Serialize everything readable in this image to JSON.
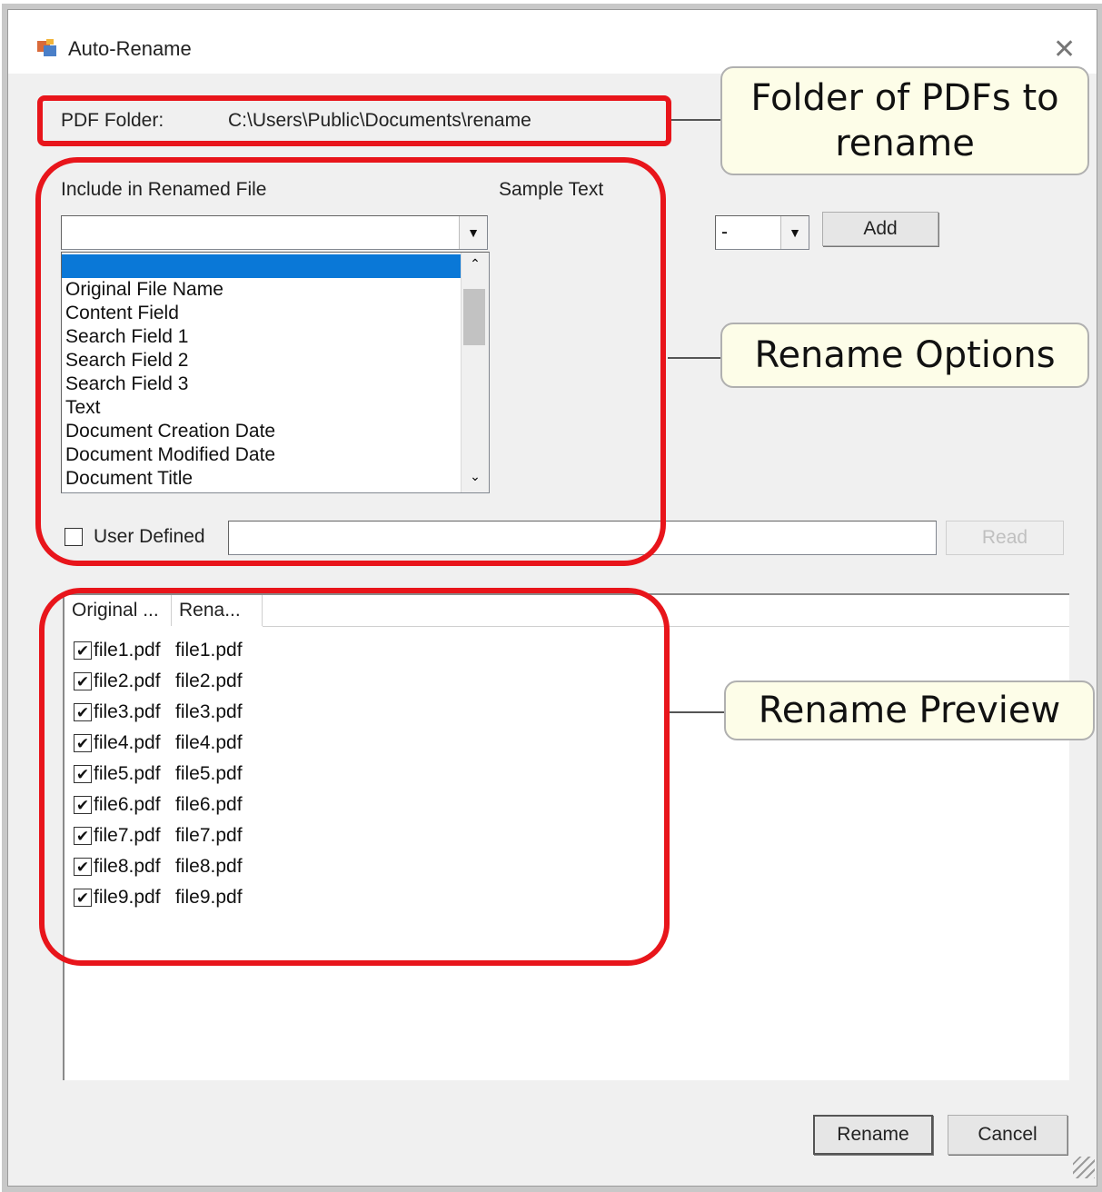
{
  "window": {
    "title": "Auto-Rename",
    "close_glyph": "✕"
  },
  "folder": {
    "label": "PDF Folder:",
    "path": "C:\\Users\\Public\\Documents\\rename"
  },
  "include": {
    "label": "Include in Renamed File",
    "sample_label": "Sample Text",
    "combo_value": "",
    "list_items": [
      "",
      "Original File Name",
      "Content Field",
      "Search Field 1",
      "Search Field 2",
      "Search Field 3",
      "Text",
      "Document Creation Date",
      "Document Modified Date",
      "Document Title"
    ],
    "selected_index": 0
  },
  "separator": {
    "value": "-",
    "add_label": "Add"
  },
  "user_defined": {
    "label": "User Defined",
    "checked": false,
    "value": "",
    "read_label": "Read"
  },
  "preview": {
    "columns": [
      "Original ...",
      "Rena..."
    ],
    "rows": [
      {
        "original": "file1.pdf",
        "renamed": "file1.pdf",
        "checked": true
      },
      {
        "original": "file2.pdf",
        "renamed": "file2.pdf",
        "checked": true
      },
      {
        "original": "file3.pdf",
        "renamed": "file3.pdf",
        "checked": true
      },
      {
        "original": "file4.pdf",
        "renamed": "file4.pdf",
        "checked": true
      },
      {
        "original": "file5.pdf",
        "renamed": "file5.pdf",
        "checked": true
      },
      {
        "original": "file6.pdf",
        "renamed": "file6.pdf",
        "checked": true
      },
      {
        "original": "file7.pdf",
        "renamed": "file7.pdf",
        "checked": true
      },
      {
        "original": "file8.pdf",
        "renamed": "file8.pdf",
        "checked": true
      },
      {
        "original": "file9.pdf",
        "renamed": "file9.pdf",
        "checked": true
      }
    ]
  },
  "buttons": {
    "rename": "Rename",
    "cancel": "Cancel"
  },
  "callouts": {
    "folder": "Folder of PDFs to rename",
    "options": "Rename Options",
    "preview": "Rename Preview"
  },
  "colors": {
    "highlight": "#e8151b",
    "selection": "#0a78d7",
    "callout_bg": "#fdfde8"
  }
}
